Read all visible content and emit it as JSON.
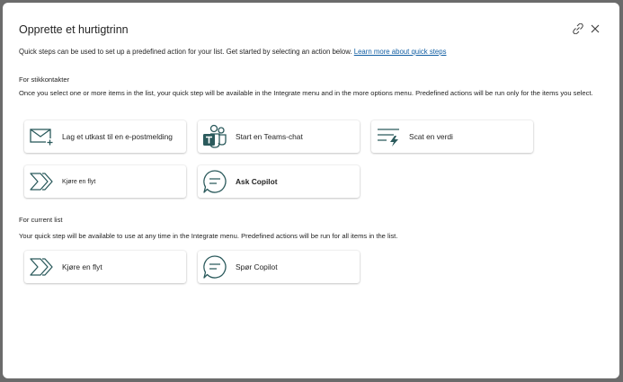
{
  "dialog": {
    "title": "Opprette et hurtigtrinn",
    "intro_text": "Quick steps can be used to set up a predefined action for your list. Get started by selecting an action below.",
    "intro_link": "Learn more about quick steps"
  },
  "section_items": {
    "title": "For stikkontakter",
    "description": "Once you select one or more items in the list, your quick step will be available in the Integrate menu and in the more options menu. Predefined actions will be run only for the items you select.",
    "cards": [
      {
        "label": "Lag et utkast til en e-postmelding",
        "icon": "mail-add-icon"
      },
      {
        "label": "Start en Teams-chat",
        "icon": "teams-icon"
      },
      {
        "label": "Scat en verdi",
        "icon": "set-value-icon"
      },
      {
        "label": "Kjøre en flyt",
        "icon": "flow-icon"
      },
      {
        "label": "Ask Copilot",
        "icon": "chat-icon"
      }
    ]
  },
  "section_list": {
    "title": "For current list",
    "description": "Your quick step will be available to use at any time in the Integrate menu. Predefined actions will be run for all items in the list.",
    "cards": [
      {
        "label": "Kjøre en flyt",
        "icon": "flow-icon"
      },
      {
        "label": "Spør Copilot",
        "icon": "chat-icon"
      }
    ]
  },
  "colors": {
    "icon": "#2b5a5c",
    "link": "#115ea3"
  }
}
